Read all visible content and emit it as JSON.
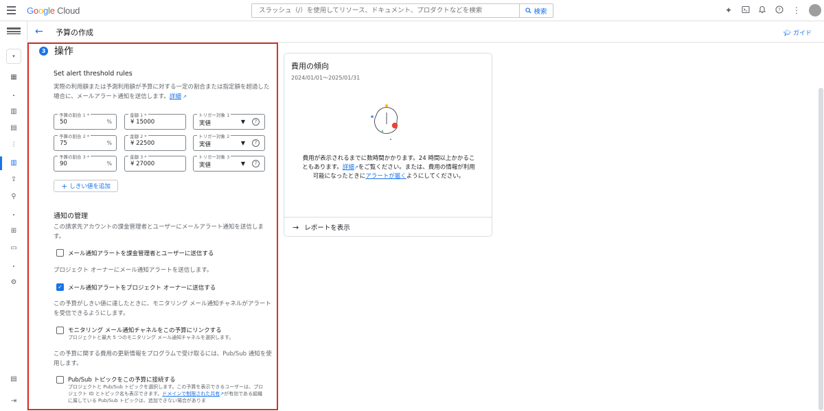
{
  "topbar": {
    "logo": {
      "g": "G",
      "o1": "o",
      "o2": "o",
      "g2": "g",
      "l": "l",
      "e": "e",
      "rest": " Cloud"
    },
    "search_placeholder": "スラッシュ（/）を使用してリソース、ドキュメント、プロダクトなどを検索",
    "search_button": "検索"
  },
  "header": {
    "title": "予算の作成",
    "guide": "ガイド"
  },
  "step": {
    "number": "3",
    "title": "操作"
  },
  "threshold": {
    "heading": "Set alert threshold rules",
    "description": "実際の利用額または予測利用額が予算に対する一定の割合または指定額を超過した場合に、メールアラート通知を送信します。",
    "details_link": "詳細",
    "rows": [
      {
        "pct_label": "予算の割合 1 *",
        "pct": "50",
        "amt_label": "金額 1 *",
        "amt": "¥ 15000",
        "trig_label": "トリガー対象 1",
        "trig": "実値"
      },
      {
        "pct_label": "予算の割合 2 *",
        "pct": "75",
        "amt_label": "金額 2 *",
        "amt": "¥ 22500",
        "trig_label": "トリガー対象 2",
        "trig": "実値"
      },
      {
        "pct_label": "予算の割合 3 *",
        "pct": "90",
        "amt_label": "金額 3 *",
        "amt": "¥ 27000",
        "trig_label": "トリガー対象 3",
        "trig": "実値"
      }
    ],
    "pct_suffix": "%",
    "add_button": "しきい値を追加"
  },
  "notifications": {
    "heading": "通知の管理",
    "desc1": "この請求先アカウントの課金管理者とユーザーにメールアラート通知を送信します。",
    "cb1": "メール通知アラートを課金管理者とユーザーに送信する",
    "desc2": "プロジェクト オーナーにメール通知アラートを送信します。",
    "cb2": "メール通知アラートをプロジェクト オーナーに送信する",
    "desc3": "この予算がしきい値に達したときに、モニタリング メール通知チャネルがアラートを受信できるようにします。",
    "cb3": "モニタリング メール通知チャネルをこの予算にリンクする",
    "cb3_help": "プロジェクトと最大 5 つのモニタリング メール通知チャネルを選択します。",
    "desc4": "この予算に関する費用の更新情報をプログラムで受け取るには、Pub/Sub 通知を使用します。",
    "cb4": "Pub/Sub トピックをこの予算に接続する",
    "cb4_help_a": "プロジェクトと Pub/Sub トピックを選択します。この予算を表示できるユーザーは、プロジェクト ID とトピック名も表示できます。",
    "cb4_help_link": "ドメインで制限された共有",
    "cb4_help_b": "が有効である組織に属している Pub/Sub トピックは、追加できない場合がありま"
  },
  "cost_card": {
    "title": "費用の傾向",
    "date_range": "2024/01/01～2025/01/31",
    "msg_a": "費用が表示されるまでに数時間かかります。24 時間以上かかることもあります。",
    "msg_link1": "詳細",
    "msg_b": "をご覧ください。または、費用の情報が利用可能になったときに",
    "msg_link2": "アラートが届く",
    "msg_c": "ようにしてください。",
    "action": "レポートを表示"
  },
  "colors": {
    "accent": "#1a73e8",
    "highlight_border": "#d93025"
  }
}
